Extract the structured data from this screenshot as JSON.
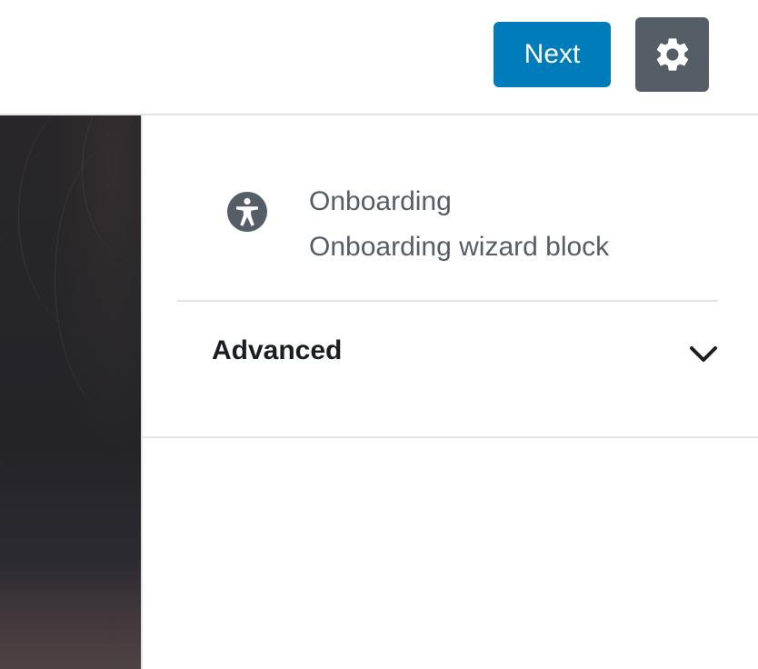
{
  "header": {
    "next_label": "Next",
    "settings_icon": "gear-icon",
    "accent_color": "#007cba",
    "settings_bg": "#555d66"
  },
  "sidebar": {
    "block_card": {
      "icon": "accessibility-icon",
      "title": "Onboarding",
      "description": "Onboarding wizard block"
    },
    "advanced_panel": {
      "label": "Advanced",
      "icon": "chevron-down-icon",
      "expanded": false
    }
  }
}
